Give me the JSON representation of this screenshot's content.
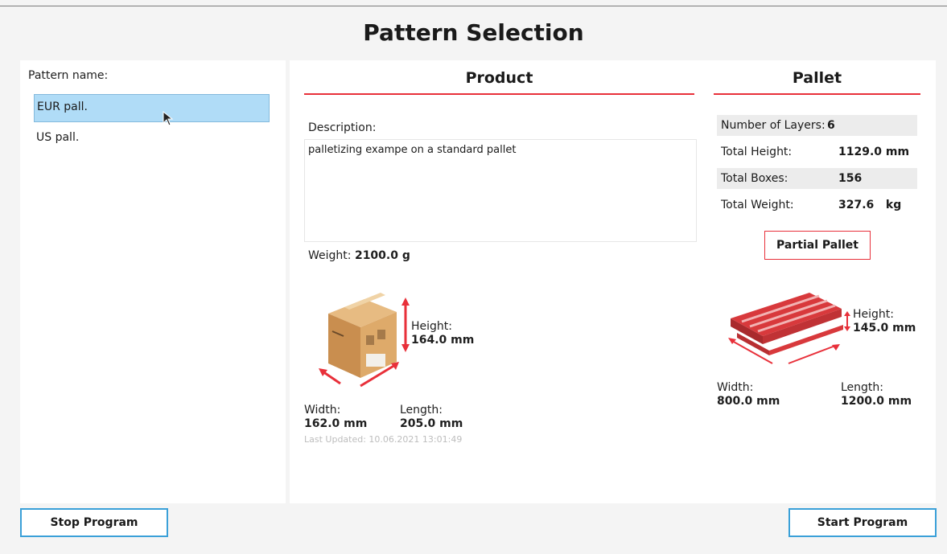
{
  "window": {
    "title": "Pattern Selection"
  },
  "patterns": {
    "label": "Pattern name:",
    "items": [
      {
        "name": "EUR pall.",
        "selected": true
      },
      {
        "name": "US pall.",
        "selected": false
      }
    ]
  },
  "product": {
    "title": "Product",
    "description_label": "Description:",
    "description": "palletizing exampe on a standard pallet",
    "weight_label": "Weight:",
    "weight_value": "2100.0 g",
    "height_label": "Height:",
    "height_value": "164.0 mm",
    "width_label": "Width:",
    "width_value": "162.0 mm",
    "length_label": "Length:",
    "length_value": "205.0 mm",
    "last_updated": "Last Updated: 10.06.2021 13:01:49"
  },
  "pallet": {
    "title": "Pallet",
    "stats": [
      {
        "label": "Number of Layers:",
        "value": "6"
      },
      {
        "label": "Total Height:",
        "value": "1129.0 mm"
      },
      {
        "label": "Total Boxes:",
        "value": "156"
      },
      {
        "label": "Total Weight:",
        "value": "327.6   kg"
      }
    ],
    "partial_button": "Partial Pallet",
    "height_label": "Height:",
    "height_value": "145.0 mm",
    "width_label": "Width:",
    "width_value": "800.0 mm",
    "length_label": "Length:",
    "length_value": "1200.0 mm"
  },
  "footer": {
    "stop_button": "Stop Program",
    "start_button": "Start Program"
  },
  "colors": {
    "accent_red": "#e8303a",
    "accent_blue": "#3aa0d8",
    "selection": "#b0dcf7",
    "pallet_red": "#d8393c",
    "box_tan": "#d9a56a"
  }
}
